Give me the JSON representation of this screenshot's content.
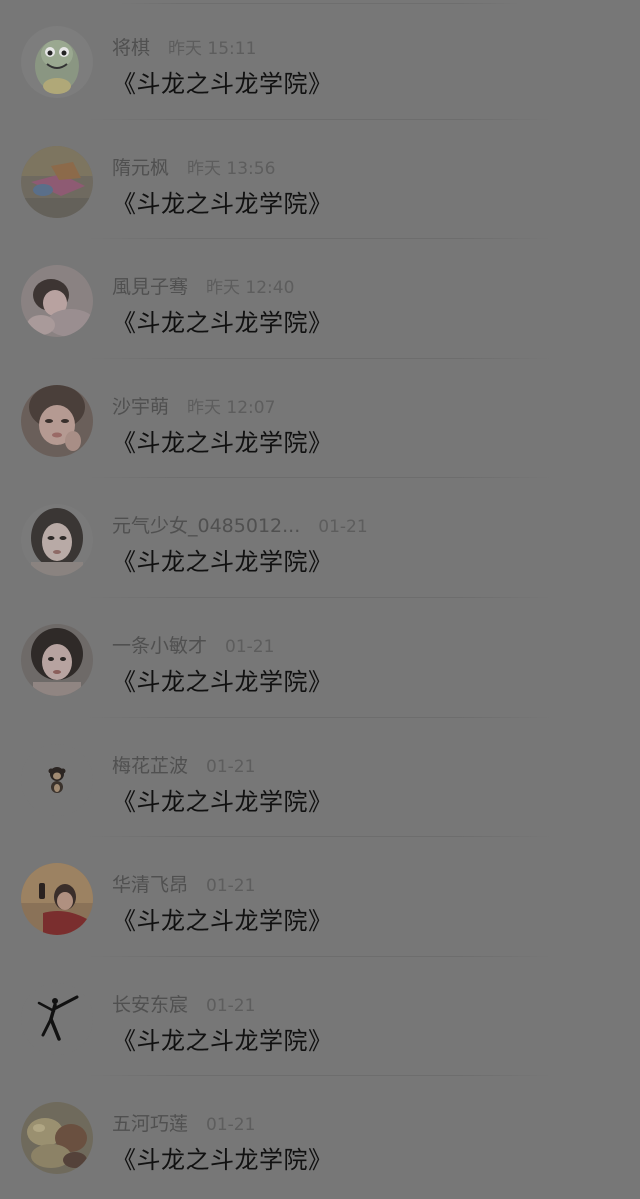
{
  "items": [
    {
      "name": "将棋",
      "time": "昨天 15:11",
      "title": "《斗龙之斗龙学院》",
      "avatar": "cartoon-avatar"
    },
    {
      "name": "隋元枫",
      "time": "昨天 13:56",
      "title": "《斗龙之斗龙学院》",
      "avatar": "game-character-avatar"
    },
    {
      "name": "風見子骞",
      "time": "昨天 12:40",
      "title": "《斗龙之斗龙学院》",
      "avatar": "person-avatar"
    },
    {
      "name": "沙宇萌",
      "time": "昨天 12:07",
      "title": "《斗龙之斗龙学院》",
      "avatar": "person-avatar"
    },
    {
      "name": "元气少女_0485012...",
      "time": "01-21",
      "title": "《斗龙之斗龙学院》",
      "avatar": "person-avatar"
    },
    {
      "name": "一条小敏才",
      "time": "01-21",
      "title": "《斗龙之斗龙学院》",
      "avatar": "person-avatar"
    },
    {
      "name": "梅花芷波",
      "time": "01-21",
      "title": "《斗龙之斗龙学院》",
      "avatar": "monkey-avatar"
    },
    {
      "name": "华清飞昂",
      "time": "01-21",
      "title": "《斗龙之斗龙学院》",
      "avatar": "person-avatar"
    },
    {
      "name": "长安东宸",
      "time": "01-21",
      "title": "《斗龙之斗龙学院》",
      "avatar": "taekwondo-figure-avatar"
    },
    {
      "name": "五河巧莲",
      "time": "01-21",
      "title": "《斗龙之斗龙学院》",
      "avatar": "food-photo-avatar"
    }
  ]
}
